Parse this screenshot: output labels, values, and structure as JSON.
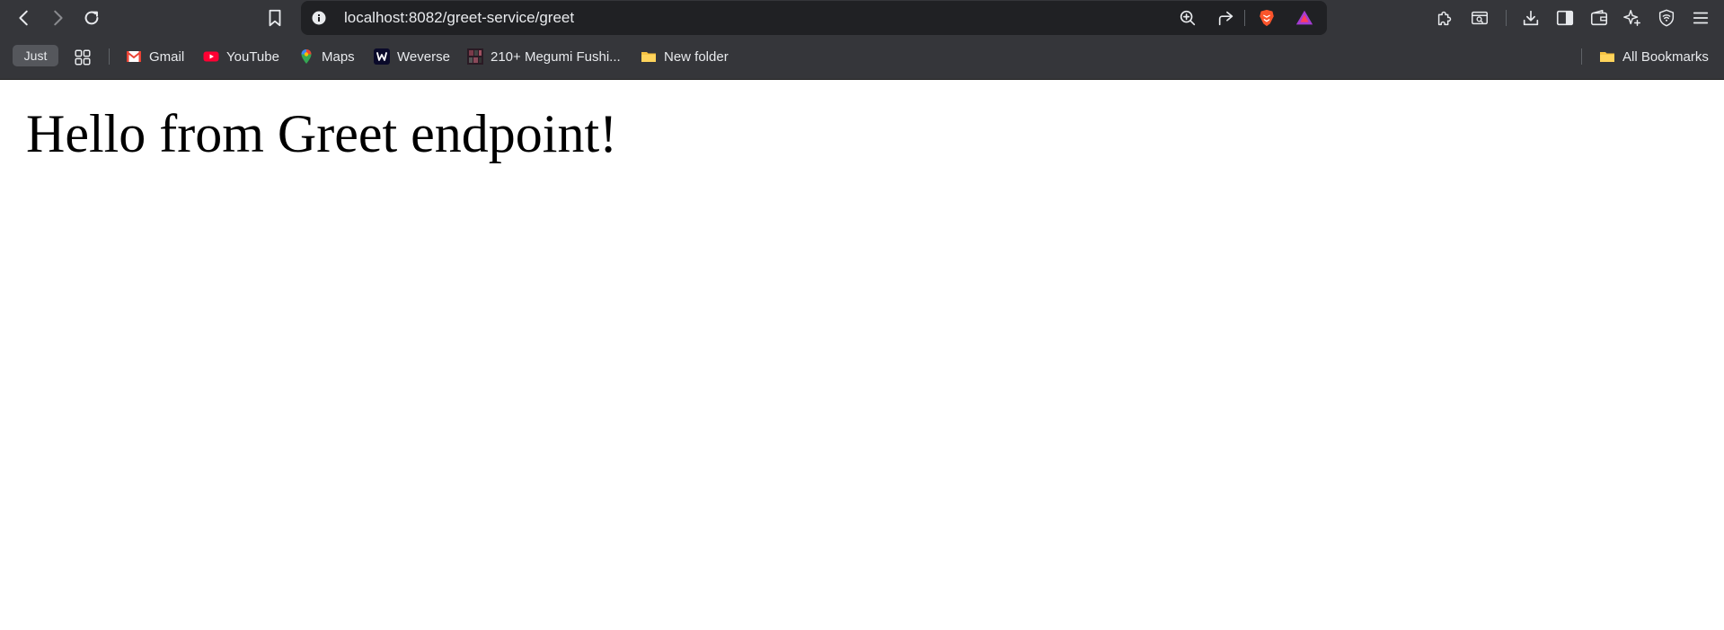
{
  "browser": {
    "address_bar": {
      "url": "localhost:8082/greet-service/greet"
    },
    "bookmarks": {
      "chip_label": "Just",
      "items": [
        {
          "label": "Gmail",
          "icon": "gmail-icon"
        },
        {
          "label": "YouTube",
          "icon": "youtube-icon"
        },
        {
          "label": "Maps",
          "icon": "maps-icon"
        },
        {
          "label": "Weverse",
          "icon": "weverse-icon"
        },
        {
          "label": "210+ Megumi Fushi...",
          "icon": "thumbnail-icon"
        },
        {
          "label": "New folder",
          "icon": "folder-icon"
        }
      ],
      "all_bookmarks": "All Bookmarks"
    }
  },
  "page": {
    "heading": "Hello from Greet endpoint!"
  },
  "colors": {
    "toolbar_bg": "#35363a",
    "omnibox_bg": "#202124",
    "text_light": "#e8eaed",
    "page_bg": "#ffffff"
  }
}
